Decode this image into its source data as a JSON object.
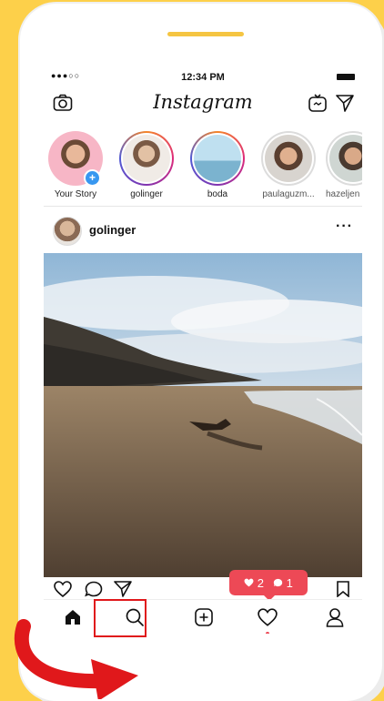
{
  "status_bar": {
    "signal": "●●●○○",
    "time": "12:34 PM"
  },
  "header": {
    "title": "Instagram"
  },
  "icons": {
    "camera": "camera-icon",
    "tv": "igtv-icon",
    "direct": "paper-plane-icon",
    "home": "home-icon",
    "search": "search-icon",
    "add": "add-post-icon",
    "activity": "heart-icon",
    "profile": "profile-icon"
  },
  "stories": [
    {
      "label": "Your Story"
    },
    {
      "label": "golinger"
    },
    {
      "label": "boda"
    },
    {
      "label": "paulaguzm..."
    },
    {
      "label": "hazeljen"
    }
  ],
  "post": {
    "username": "golinger",
    "more": "···"
  },
  "notification": {
    "likes": "2",
    "comments": "1"
  },
  "colors": {
    "background": "#FDD04A",
    "accent": "#ED4956",
    "highlight": "#E0181B"
  }
}
